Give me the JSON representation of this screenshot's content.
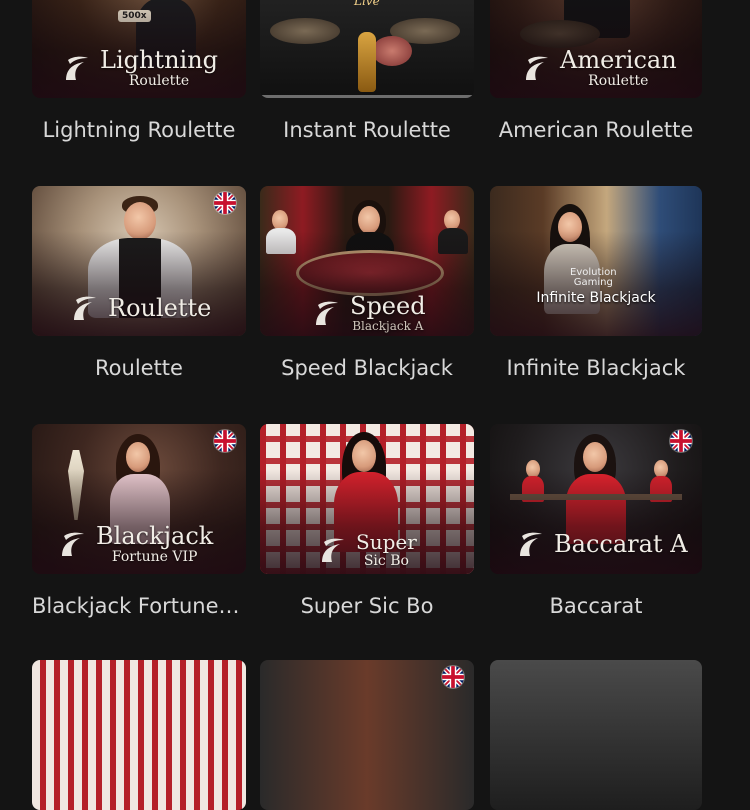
{
  "games": [
    {
      "title": "Lightning Roulette",
      "logo_main": "Lightning",
      "logo_sub": "Roulette",
      "badge": "500x",
      "flag": false
    },
    {
      "title": "Instant Roulette",
      "logo_main": "",
      "logo_sub": "",
      "badge": "Live",
      "flag": false
    },
    {
      "title": "American Roulette",
      "logo_main": "American",
      "logo_sub": "Roulette",
      "flag": false
    },
    {
      "title": "Roulette",
      "logo_main": "Roulette",
      "logo_sub": "",
      "flag": true
    },
    {
      "title": "Speed Blackjack",
      "logo_main": "Speed",
      "logo_sub": "Blackjack A",
      "flag": false
    },
    {
      "title": "Infinite Blackjack",
      "logo_main": "Infinite Blackjack",
      "logo_sub": "",
      "provider_top": "Evolution",
      "provider_bottom": "Gaming",
      "flag": false
    },
    {
      "title": "Blackjack Fortune …",
      "logo_main": "Blackjack",
      "logo_sub": "Fortune VIP",
      "flag": true
    },
    {
      "title": "Super Sic Bo",
      "logo_main": "Super",
      "logo_sub": "Sic Bo",
      "flag": false
    },
    {
      "title": "Baccarat",
      "logo_main": "Baccarat A",
      "logo_sub": "",
      "flag": true
    }
  ],
  "icons": {
    "provider_logo": "evolution-swoosh-icon",
    "flag": "uk-flag-icon"
  },
  "colors": {
    "background": "#141414",
    "title_text": "#d8d8d8",
    "logo_text": "#f1ede6"
  }
}
